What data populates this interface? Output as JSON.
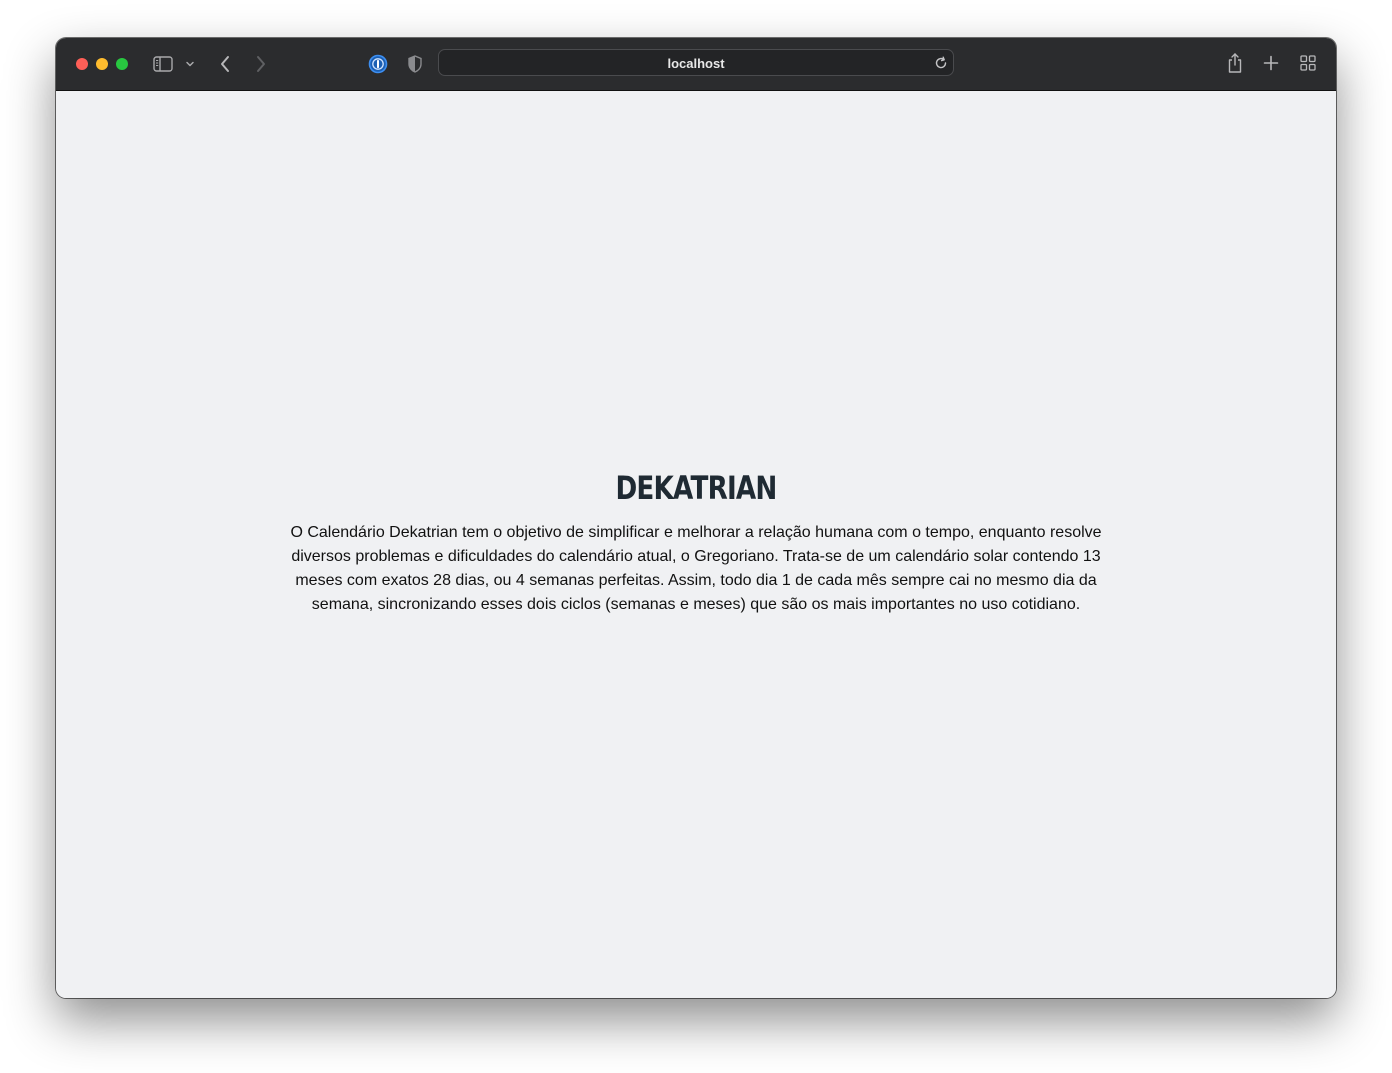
{
  "browser": {
    "url": "localhost",
    "icons": {
      "sidebar": "sidebar-icon",
      "sidebar_menu": "chevron-down-icon",
      "back": "back-arrow-icon",
      "forward": "forward-arrow-icon",
      "password_manager": "password-manager-icon",
      "privacy": "shield-icon",
      "reload": "reload-icon",
      "share": "share-icon",
      "new_tab": "plus-icon",
      "tab_overview": "tab-overview-icon"
    }
  },
  "page": {
    "title": "DEKATRIAN",
    "description": "O Calendário Dekatrian tem o objetivo de simplificar e melhorar a relação humana com o tempo, enquanto resolve diversos problemas e dificuldades do calendário atual, o Gregoriano. Trata-se de um calendário solar contendo 13 meses com exatos 28 dias, ou 4 semanas perfeitas. Assim, todo dia 1 de cada mês sempre cai no mesmo dia da semana, sincronizando esses dois ciclos (semanas e meses) que são os mais importantes no uso cotidiano."
  },
  "colors": {
    "toolbar": "#2b2c2e",
    "page_background": "#f0f1f3",
    "title": "#1f2a33",
    "close": "#ff5f57",
    "minimize": "#febc2e",
    "maximize": "#28c840"
  }
}
